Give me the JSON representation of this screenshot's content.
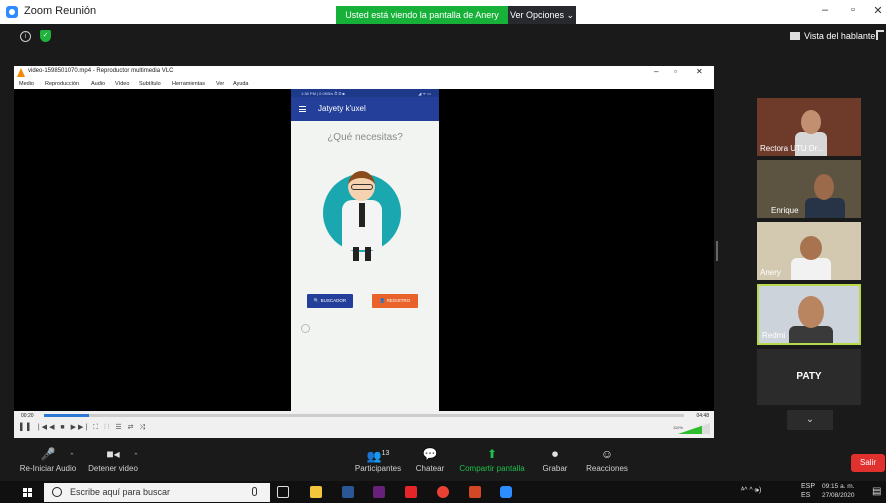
{
  "window": {
    "title": "Zoom Reunión",
    "share_banner": "Usted está viendo la pantalla de Anery",
    "view_options": "Ver Opciones",
    "view_options_caret": "⌄",
    "minimize": "–",
    "maximize": "▫",
    "close": "✕"
  },
  "topbar": {
    "info_glyph": "i",
    "shield_glyph": "✓",
    "speaker_view": "Vista del hablante"
  },
  "vlc": {
    "title": "video-1598501070.mp4 - Reproductor multimedia VLC",
    "menu": [
      "Medio",
      "Reproducción",
      "Audio",
      "Vídeo",
      "Subtítulo",
      "Herramientas",
      "Ver",
      "Ayuda"
    ],
    "controls": {
      "minimize": "–",
      "maximize": "▫",
      "close": "✕"
    },
    "phone": {
      "status_left": "1:38 PM | 0.0KB/s ⏱ ✉ ■",
      "status_right": "◢ ᯤ ▭",
      "app_title": "Jatyety k'uxel",
      "question": "¿Qué necesitas?",
      "btn_buscador": "🔍 BUSCADOR",
      "btn_registro": "👤 REGISTRO"
    },
    "time_elapsed": "00:20",
    "time_total": "04:48",
    "playback_progress": 0.07,
    "volume_percent": "110%",
    "volume_level": 0.75,
    "control_glyphs": "▌▌ |◀◀ ■ ▶▶| ⛶ ⫶⫶ ☰ ⇄ ⤨"
  },
  "participants": [
    {
      "name": "Rectora UTU Dr...",
      "colors": {
        "bg": "#6e3a2a",
        "body": "#d7d7d7"
      }
    },
    {
      "name": "Enrique",
      "colors": {
        "bg": "#5c5340",
        "body": "#273448"
      }
    },
    {
      "name": "Anery",
      "colors": {
        "bg": "#d3c9b0",
        "body": "#f2f2f2"
      }
    },
    {
      "name": "Redmi",
      "colors": {
        "bg": "#cdd3da",
        "body": "#3a3a3a"
      }
    }
  ],
  "paty": "PATY",
  "scroll_down_glyph": "⌄",
  "toolbar": {
    "audio": "Re-Iniciar Audio",
    "video": "Detener video",
    "participants": "Participantes",
    "participants_count": "13",
    "chat": "Chatear",
    "share": "Compartir pantalla",
    "record": "Grabar",
    "reactions": "Reacciones",
    "leave": "Salir",
    "caret": "⌃",
    "glyphs": {
      "audio": "🎤",
      "video": "■◂",
      "participants": "👥",
      "chat": "💬",
      "share": "⬆",
      "record": "⏺",
      "reactions": "☺"
    }
  },
  "taskbar": {
    "search_placeholder": "Escribe aquí para buscar",
    "tray_lang": "ESP",
    "tray_lang2": "ES",
    "time": "09:15 a. m.",
    "date": "27/08/2020",
    "tray_icons": "ᴬ^ ^ 🕪)",
    "notify_glyph": "▤",
    "apps": [
      {
        "name": "task-view",
        "color": "#ffffff"
      },
      {
        "name": "file-explorer",
        "color": "#f2c53d"
      },
      {
        "name": "word",
        "color": "#2b5797"
      },
      {
        "name": "visual-studio",
        "color": "#68217a"
      },
      {
        "name": "acrobat",
        "color": "#e5252a"
      },
      {
        "name": "chrome",
        "color": "#e94235"
      },
      {
        "name": "powerpoint",
        "color": "#d24726"
      },
      {
        "name": "zoom",
        "color": "#2d8cff"
      }
    ]
  }
}
